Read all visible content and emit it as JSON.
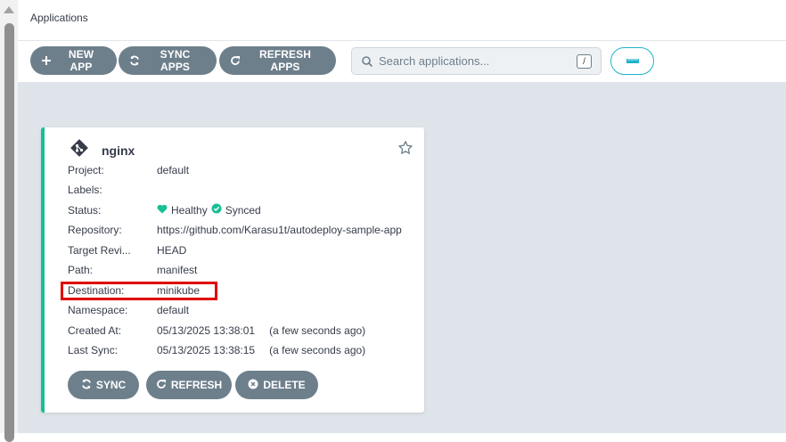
{
  "page": {
    "title": "Applications"
  },
  "toolbar": {
    "new_app": "NEW APP",
    "sync_apps": "SYNC APPS",
    "refresh_apps": "REFRESH APPS",
    "search_placeholder": "Search applications...",
    "search_shortcut": "/"
  },
  "colors": {
    "accent_teal": "#18be94",
    "button_gray": "#6d7f8b",
    "highlight_red": "#e00000",
    "content_bg": "#dee4ea"
  },
  "app": {
    "name": "nginx",
    "icon": "git-icon",
    "fields": {
      "project_label": "Project:",
      "project": "default",
      "labels_label": "Labels:",
      "labels": "",
      "status_label": "Status:",
      "health": "Healthy",
      "sync": "Synced",
      "repo_label": "Repository:",
      "repo": "https://github.com/Karasu1t/autodeploy-sample-app",
      "revision_label": "Target Revi...",
      "revision": "HEAD",
      "path_label": "Path:",
      "path": "manifest",
      "destination_label": "Destination:",
      "destination": "minikube",
      "namespace_label": "Namespace:",
      "namespace": "default",
      "created_label": "Created At:",
      "created": "05/13/2025 13:38:01",
      "created_rel": "(a few seconds ago)",
      "lastsync_label": "Last Sync:",
      "lastsync": "05/13/2025 13:38:15",
      "lastsync_rel": "(a few seconds ago)"
    },
    "actions": {
      "sync": "SYNC",
      "refresh": "REFRESH",
      "delete": "DELETE"
    }
  }
}
